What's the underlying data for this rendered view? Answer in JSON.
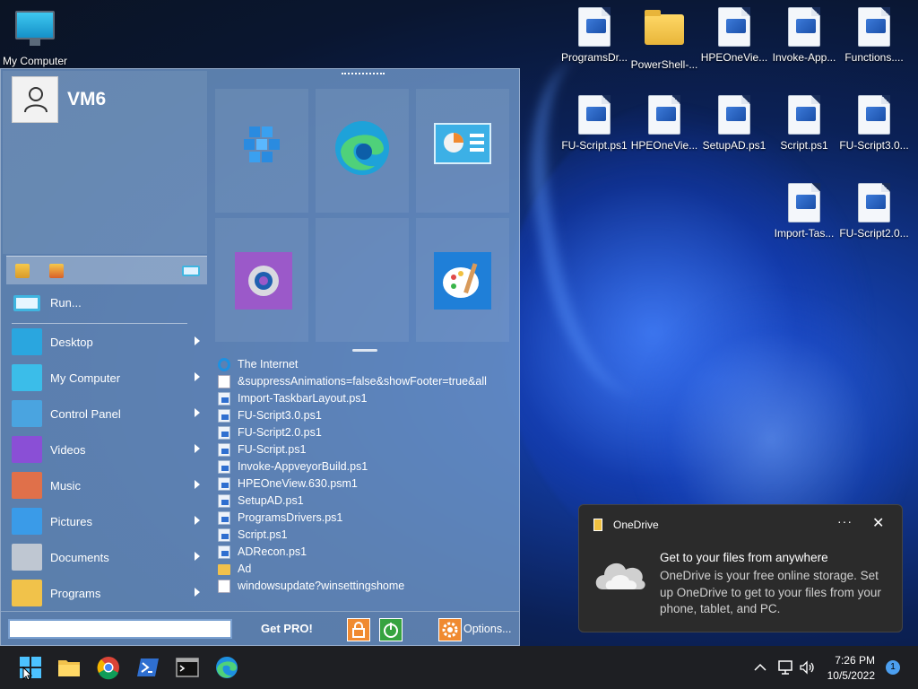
{
  "desktop": {
    "left_icon": {
      "label": "My Computer",
      "icon": "monitor-icon"
    },
    "icons": [
      {
        "label": "ProgramsDr...",
        "icon": "powershell-file-icon"
      },
      {
        "label": "PowerShell-...",
        "icon": "folder-icon"
      },
      {
        "label": "HPEOneVie...",
        "icon": "powershell-file-icon"
      },
      {
        "label": "Invoke-App...",
        "icon": "powershell-file-icon"
      },
      {
        "label": "Functions....",
        "icon": "powershell-file-icon"
      },
      {
        "label": "FU-Script.ps1",
        "icon": "powershell-file-icon"
      },
      {
        "label": "HPEOneVie...",
        "icon": "powershell-file-icon"
      },
      {
        "label": "SetupAD.ps1",
        "icon": "powershell-file-icon"
      },
      {
        "label": "Script.ps1",
        "icon": "powershell-file-icon"
      },
      {
        "label": "FU-Script3.0...",
        "icon": "powershell-file-icon"
      },
      {
        "label": "Import-Tas...",
        "icon": "powershell-file-icon"
      },
      {
        "label": "FU-Script2.0...",
        "icon": "powershell-file-icon"
      }
    ]
  },
  "start_menu": {
    "username": "VM6",
    "run_label": "Run...",
    "menu_items": [
      {
        "label": "Desktop",
        "icon": "desktop-icon",
        "color": "#2aa6df"
      },
      {
        "label": "My Computer",
        "icon": "computer-icon",
        "color": "#3bbde9"
      },
      {
        "label": "Control Panel",
        "icon": "control-panel-icon",
        "color": "#4aa4e0"
      },
      {
        "label": "Videos",
        "icon": "videos-icon",
        "color": "#8a4fd6"
      },
      {
        "label": "Music",
        "icon": "music-icon",
        "color": "#e0704a"
      },
      {
        "label": "Pictures",
        "icon": "pictures-icon",
        "color": "#3a9be8"
      },
      {
        "label": "Documents",
        "icon": "documents-icon",
        "color": "#bfc7d2"
      },
      {
        "label": "Programs",
        "icon": "programs-folder-icon",
        "color": "#f1c24a"
      }
    ],
    "tiles": [
      {
        "name": "tile-tool",
        "icon": "cube-stack-icon",
        "color": "#2a8be0"
      },
      {
        "name": "tile-edge",
        "icon": "edge-icon",
        "color": "#1ea2d9"
      },
      {
        "name": "tile-control-panel",
        "icon": "control-panel-icon",
        "color": "#3cb0e6"
      },
      {
        "name": "tile-settings",
        "icon": "gear-icon",
        "color": "#9b59c9"
      },
      {
        "name": "tile-paint",
        "icon": "paint-icon",
        "color": "#1f7fd8"
      }
    ],
    "recent": [
      {
        "label": "The Internet",
        "kind": "ie"
      },
      {
        "label": "&suppressAnimations=false&showFooter=true&all",
        "kind": "doc"
      },
      {
        "label": "Import-TaskbarLayout.ps1",
        "kind": "ps"
      },
      {
        "label": "FU-Script3.0.ps1",
        "kind": "ps"
      },
      {
        "label": "FU-Script2.0.ps1",
        "kind": "ps"
      },
      {
        "label": "FU-Script.ps1",
        "kind": "ps"
      },
      {
        "label": "Invoke-AppveyorBuild.ps1",
        "kind": "ps"
      },
      {
        "label": "HPEOneView.630.psm1",
        "kind": "ps"
      },
      {
        "label": "SetupAD.ps1",
        "kind": "ps"
      },
      {
        "label": "ProgramsDrivers.ps1",
        "kind": "ps"
      },
      {
        "label": "Script.ps1",
        "kind": "ps"
      },
      {
        "label": "ADRecon.ps1",
        "kind": "ps"
      },
      {
        "label": "Ad",
        "kind": "folder"
      },
      {
        "label": "windowsupdate?winsettingshome",
        "kind": "doc"
      }
    ],
    "search_value": "",
    "get_pro": "Get PRO!",
    "options": "Options..."
  },
  "toast": {
    "app": "OneDrive",
    "more": "···",
    "close": "✕",
    "title": "Get to your files from anywhere",
    "body": "OneDrive is your free online storage. Set up OneDrive to get to your files from your phone, tablet, and PC."
  },
  "taskbar": {
    "apps": [
      "start-icon",
      "file-explorer-icon",
      "chrome-icon",
      "powershell-icon",
      "terminal-icon",
      "edge-icon"
    ],
    "time": "7:26 PM",
    "date": "10/5/2022",
    "notifications": "1"
  },
  "colors": {
    "accent": "#1e90e0",
    "menu_bg": "#6e96c8",
    "taskbar": "#1e1f23"
  }
}
